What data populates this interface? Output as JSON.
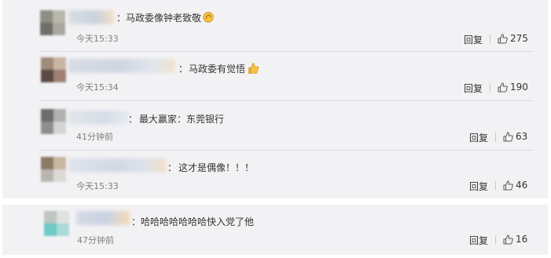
{
  "comments": [
    {
      "text": "马政委像钟老致敬",
      "emoji": "clapping-hands-icon",
      "time": "今天15:33",
      "reply": "回复",
      "likes": "275"
    },
    {
      "text": "马政委有觉悟",
      "emoji": "thumbs-up-icon",
      "time": "今天15:34",
      "reply": "回复",
      "likes": "190"
    },
    {
      "text": "最大赢家：东莞银行",
      "emoji": "",
      "time": "41分钟前",
      "reply": "回复",
      "likes": "63"
    },
    {
      "text": "这才是偶像！！！",
      "emoji": "",
      "time": "今天15:33",
      "reply": "回复",
      "likes": "46"
    },
    {
      "text": "哈哈哈哈哈哈哈快入党了他",
      "emoji": "",
      "time": "47分钟前",
      "reply": "回复",
      "likes": "16"
    }
  ],
  "colon": "：",
  "colors": {
    "panel": "#f2f2f5",
    "text": "#333333",
    "muted": "#808080",
    "emoji_yellow": "#f5c242"
  }
}
